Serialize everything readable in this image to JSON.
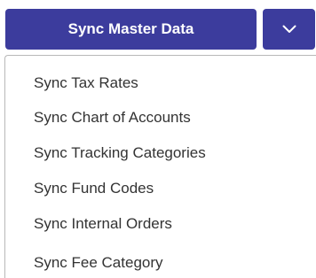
{
  "main_button": {
    "label": "Sync Master Data",
    "color": "#3c3c9d"
  },
  "toggle": {
    "icon": "chevron-down-icon"
  },
  "menu": {
    "items": [
      {
        "label": "Sync Tax Rates"
      },
      {
        "label": "Sync Chart of Accounts"
      },
      {
        "label": "Sync Tracking Categories"
      },
      {
        "label": "Sync Fund Codes"
      },
      {
        "label": "Sync Internal Orders"
      },
      {
        "label": "Sync Fee Category"
      }
    ]
  }
}
